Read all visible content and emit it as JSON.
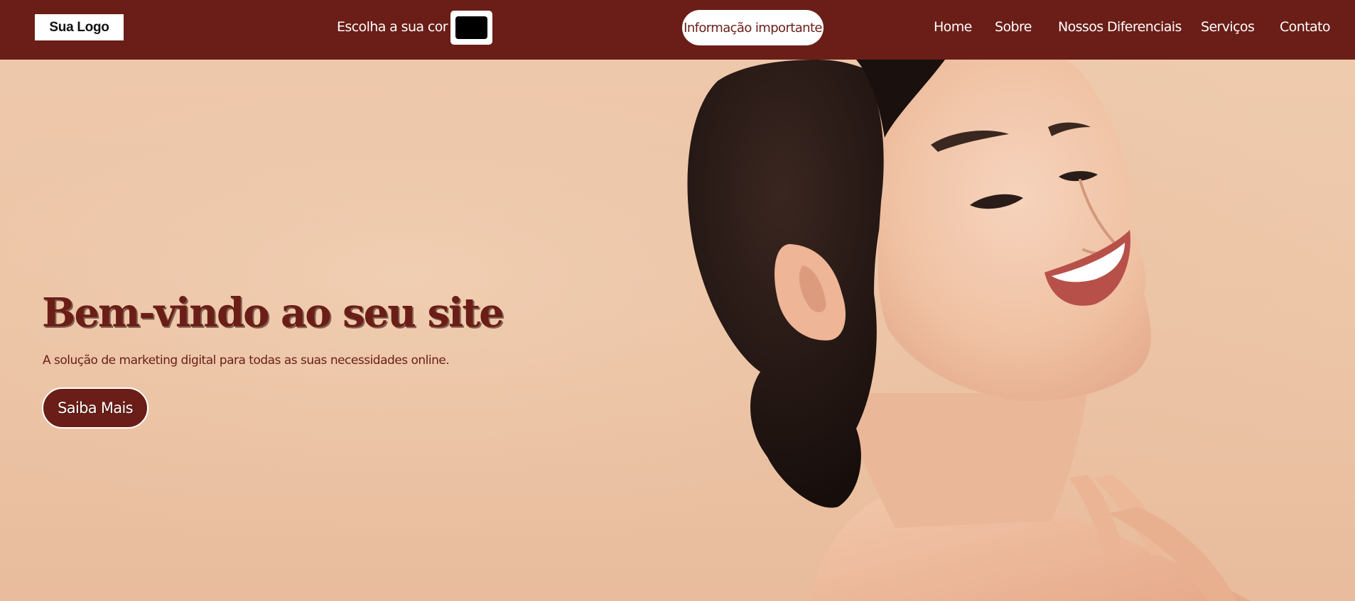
{
  "header": {
    "logo_text": "Sua Logo",
    "color_picker_label": "Escolha a sua cor",
    "selected_color": "#000000",
    "info_button_label": "Informação importante",
    "nav": [
      {
        "label": "Home"
      },
      {
        "label": "Sobre"
      },
      {
        "label": "Nossos Diferenciais"
      },
      {
        "label": "Serviços"
      },
      {
        "label": "Contato"
      }
    ]
  },
  "hero": {
    "title": "Bem-vindo ao seu site",
    "subtitle": "A solução de marketing digital para todas as suas necessidades online.",
    "cta_label": "Saiba Mais",
    "image_subject": "smiling woman with dark hair in a low bun against a peach background"
  },
  "colors": {
    "brand": "#6a1e17",
    "hero_background": "#edc7a9",
    "text_on_brand": "#ffffff"
  }
}
